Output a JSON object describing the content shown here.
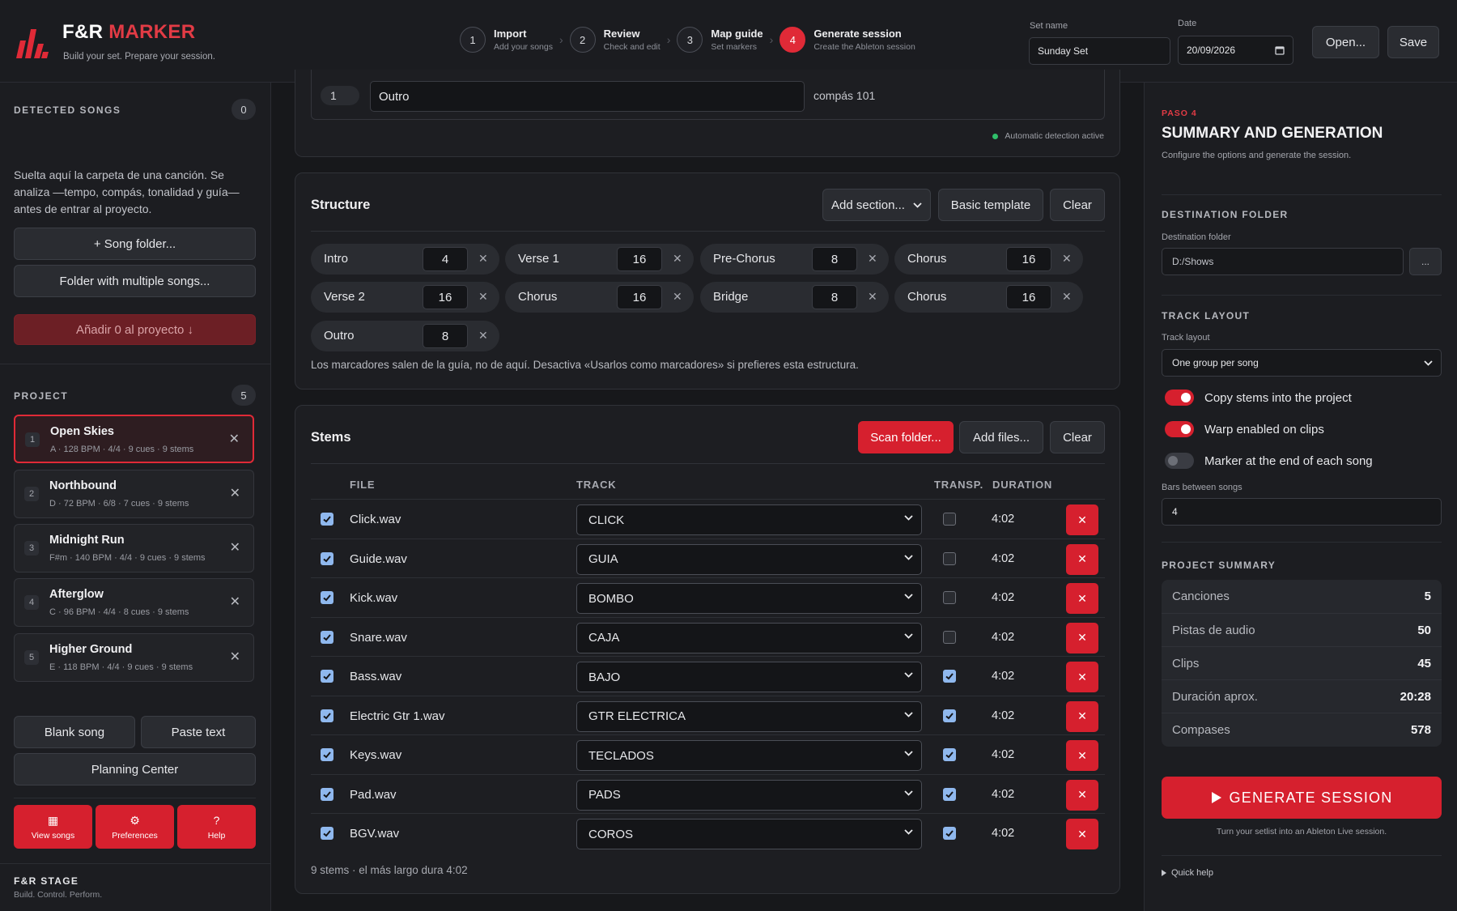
{
  "header": {
    "brand_part1": "F&R",
    "brand_part2": "MARKER",
    "tagline": "Build your set. Prepare your session.",
    "steps": [
      {
        "num": "1",
        "title": "Import",
        "sub": "Add your songs"
      },
      {
        "num": "2",
        "title": "Review",
        "sub": "Check and edit"
      },
      {
        "num": "3",
        "title": "Map guide",
        "sub": "Set markers"
      },
      {
        "num": "4",
        "title": "Generate session",
        "sub": "Create the Ableton session"
      }
    ],
    "set_name_label": "Set name",
    "set_name_value": "Sunday Set",
    "date_label": "Date",
    "date_value": "20/09/2026",
    "open_label": "Open...",
    "save_label": "Save"
  },
  "sidebar": {
    "detected_label": "DETECTED SONGS",
    "detected_count": "0",
    "drop_text": "Suelta aquí la carpeta de una canción. Se analiza —tempo, compás, tonalidad y guía— antes de entrar al proyecto.",
    "song_folder_btn": "+ Song folder...",
    "multi_folder_btn": "Folder with multiple songs...",
    "add_btn": "Añadir 0 al proyecto ↓",
    "project_label": "PROJECT",
    "project_count": "5",
    "songs": [
      {
        "num": "1",
        "title": "Open Skies",
        "meta": "A · 128 BPM · 4/4 · 9 cues · 9 stems"
      },
      {
        "num": "2",
        "title": "Northbound",
        "meta": "D · 72 BPM · 6/8 · 7 cues · 9 stems"
      },
      {
        "num": "3",
        "title": "Midnight Run",
        "meta": "F#m · 140 BPM · 4/4 · 9 cues · 9 stems"
      },
      {
        "num": "4",
        "title": "Afterglow",
        "meta": "C · 96 BPM · 4/4 · 8 cues · 9 stems"
      },
      {
        "num": "5",
        "title": "Higher Ground",
        "meta": "E · 118 BPM · 4/4 · 9 cues · 9 stems"
      }
    ],
    "blank_song_btn": "Blank song",
    "paste_text_btn": "Paste text",
    "planning_center_btn": "Planning Center",
    "view_songs_btn": "View songs",
    "preferences_btn": "Preferences",
    "help_btn": "Help",
    "footer_brand": "F&R STAGE",
    "footer_sub": "Build. Control. Perform."
  },
  "top_panel": {
    "cue_num": "1",
    "cue_name": "Outro",
    "cue_bar": "compás 101",
    "auto_detect": "Automatic detection active"
  },
  "structure": {
    "title": "Structure",
    "add_section": "Add section...",
    "basic_template": "Basic template",
    "clear": "Clear",
    "sections": [
      {
        "name": "Intro",
        "bars": "4"
      },
      {
        "name": "Verse 1",
        "bars": "16"
      },
      {
        "name": "Pre-Chorus",
        "bars": "8"
      },
      {
        "name": "Chorus",
        "bars": "16"
      },
      {
        "name": "Verse 2",
        "bars": "16"
      },
      {
        "name": "Chorus",
        "bars": "16"
      },
      {
        "name": "Bridge",
        "bars": "8"
      },
      {
        "name": "Chorus",
        "bars": "16"
      },
      {
        "name": "Outro",
        "bars": "8"
      }
    ],
    "note": "Los marcadores salen de la guía, no de aquí. Desactiva «Usarlos como marcadores» si prefieres esta estructura."
  },
  "stems": {
    "title": "Stems",
    "scan_folder": "Scan folder...",
    "add_files": "Add files...",
    "clear": "Clear",
    "columns": {
      "file": "FILE",
      "track": "TRACK",
      "transp": "TRANSP.",
      "duration": "DURATION"
    },
    "rows": [
      {
        "file": "Click.wav",
        "track": "CLICK",
        "transp": false,
        "duration": "4:02"
      },
      {
        "file": "Guide.wav",
        "track": "GUIA",
        "transp": false,
        "duration": "4:02"
      },
      {
        "file": "Kick.wav",
        "track": "BOMBO",
        "transp": false,
        "duration": "4:02"
      },
      {
        "file": "Snare.wav",
        "track": "CAJA",
        "transp": false,
        "duration": "4:02"
      },
      {
        "file": "Bass.wav",
        "track": "BAJO",
        "transp": true,
        "duration": "4:02"
      },
      {
        "file": "Electric Gtr 1.wav",
        "track": "GTR ELECTRICA",
        "transp": true,
        "duration": "4:02"
      },
      {
        "file": "Keys.wav",
        "track": "TECLADOS",
        "transp": true,
        "duration": "4:02"
      },
      {
        "file": "Pad.wav",
        "track": "PADS",
        "transp": true,
        "duration": "4:02"
      },
      {
        "file": "BGV.wav",
        "track": "COROS",
        "transp": true,
        "duration": "4:02"
      }
    ],
    "footer": "9 stems · el más largo dura 4:02"
  },
  "right": {
    "step_label": "PASO 4",
    "title": "SUMMARY AND GENERATION",
    "subtitle": "Configure the options and generate the session.",
    "dest_section": "DESTINATION FOLDER",
    "dest_label": "Destination folder",
    "dest_value": "D:/Shows",
    "browse": "...",
    "layout_section": "TRACK LAYOUT",
    "layout_label": "Track layout",
    "layout_value": "One group per song",
    "toggles": [
      {
        "label": "Copy stems into the project",
        "on": true
      },
      {
        "label": "Warp enabled on clips",
        "on": true
      },
      {
        "label": "Marker at the end of each song",
        "on": false
      }
    ],
    "bars_label": "Bars between songs",
    "bars_value": "4",
    "summary_section": "PROJECT SUMMARY",
    "summary": [
      {
        "k": "Canciones",
        "v": "5"
      },
      {
        "k": "Pistas de audio",
        "v": "50"
      },
      {
        "k": "Clips",
        "v": "45"
      },
      {
        "k": "Duración aprox.",
        "v": "20:28"
      },
      {
        "k": "Compases",
        "v": "578"
      }
    ],
    "generate": "GENERATE SESSION",
    "generate_sub": "Turn your setlist into an Ableton Live session.",
    "quick_help": "Quick help"
  },
  "colors": {
    "accent": "#d6202e",
    "bg": "#17181b",
    "panel": "#1d1e22",
    "check": "#8fb8ee"
  }
}
